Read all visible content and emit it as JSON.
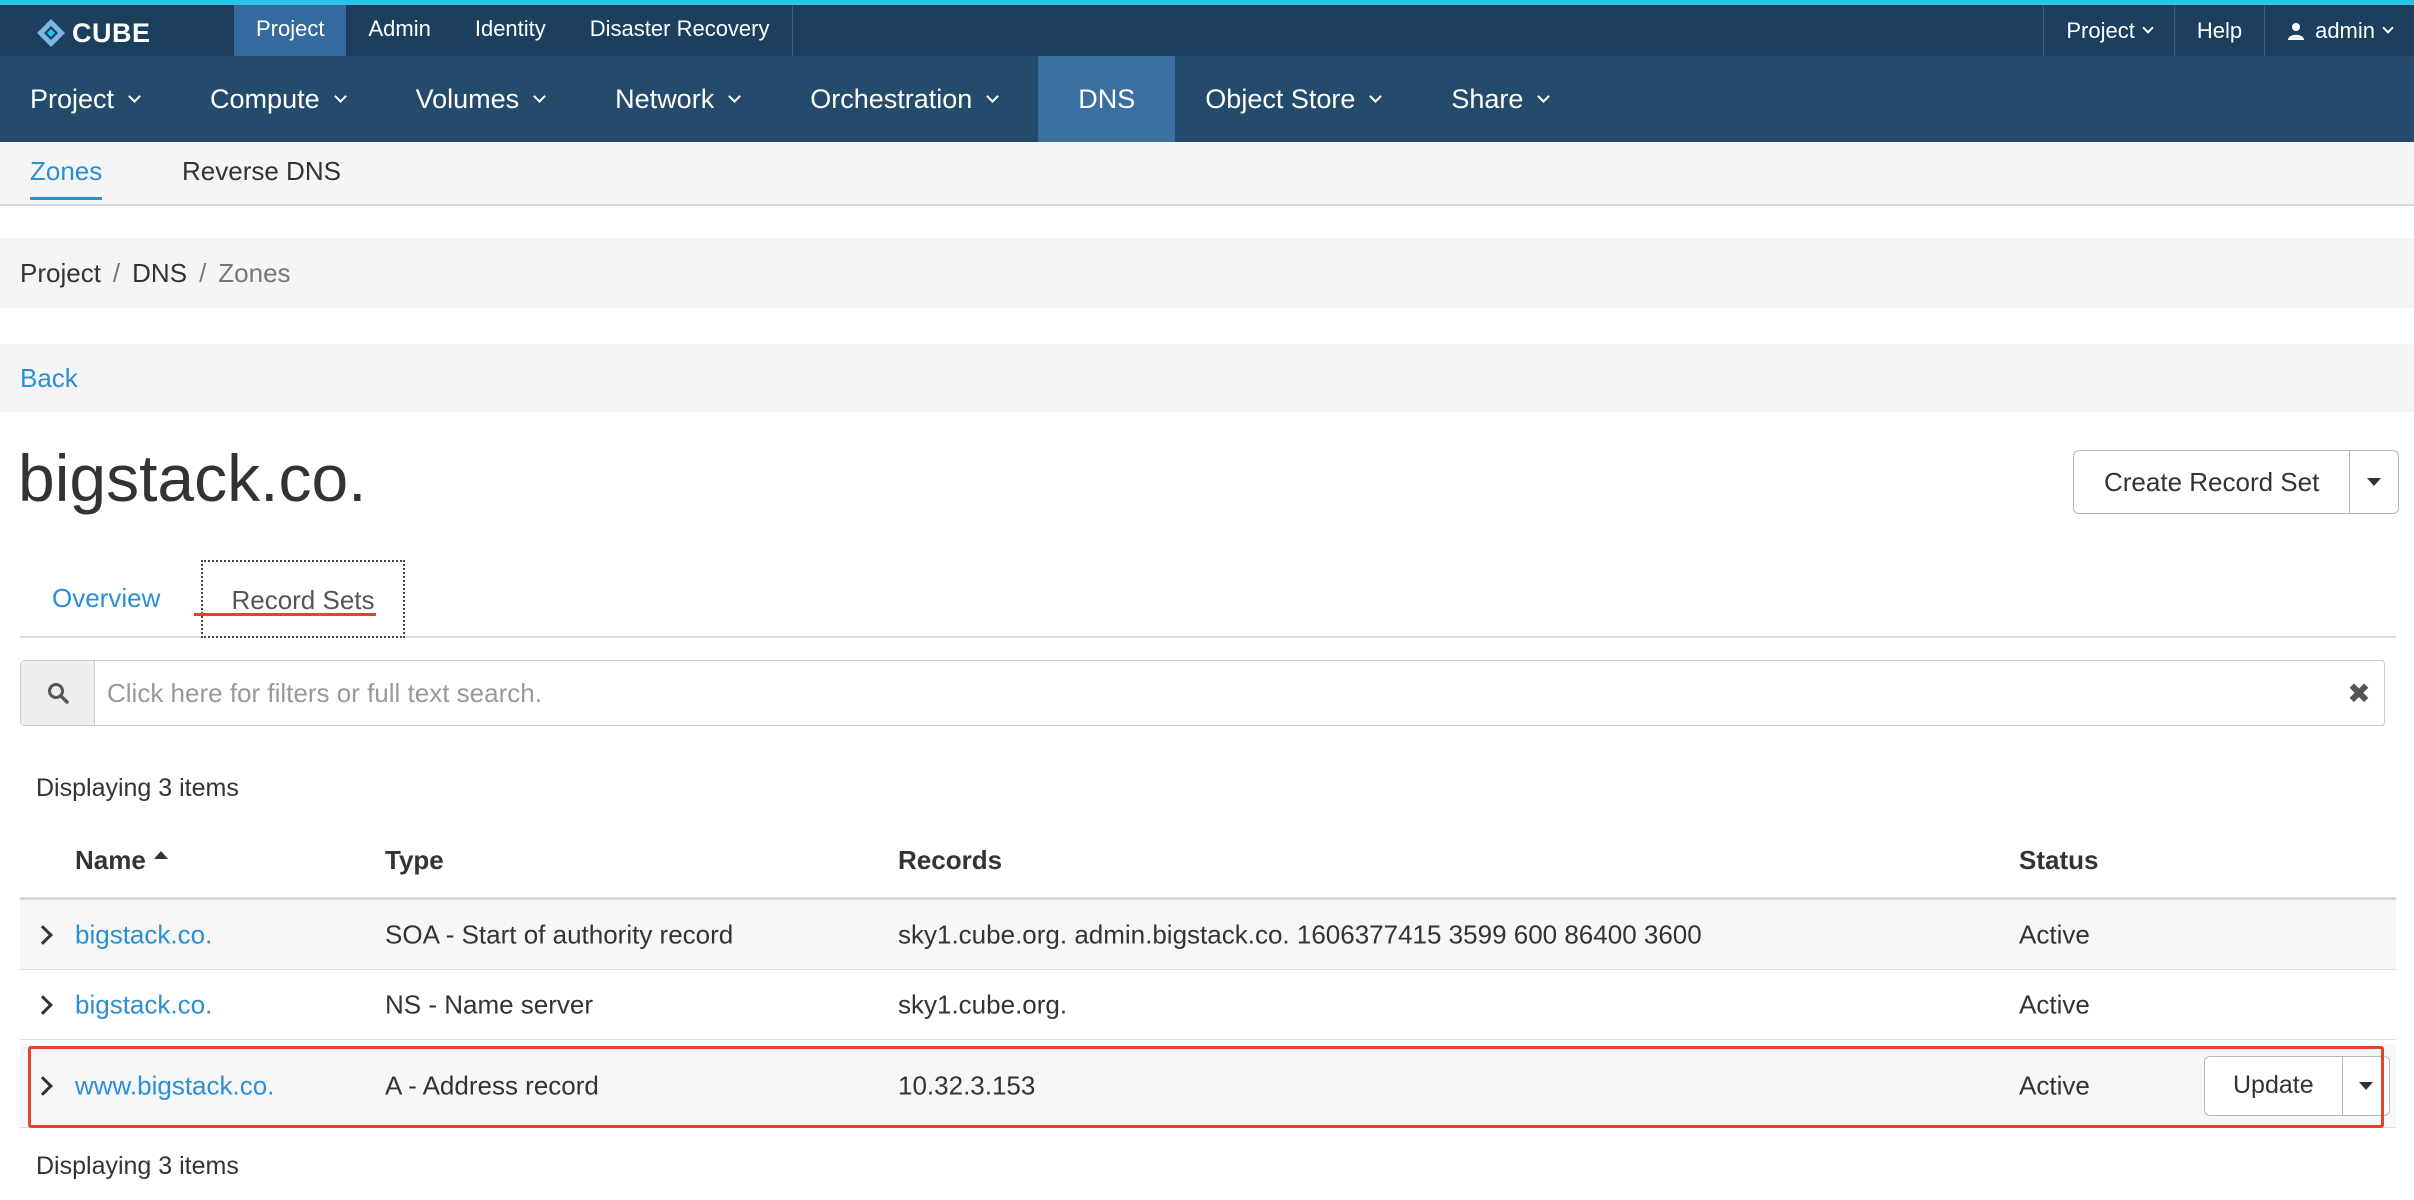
{
  "brand": {
    "name": "CUBE",
    "accent": "#27c3e8",
    "link_color": "#2a8fd4",
    "highlight_color": "#e0442b"
  },
  "topbar": {
    "left_items": [
      "Project",
      "Admin",
      "Identity",
      "Disaster Recovery"
    ],
    "active_left": "Project",
    "right_items": {
      "project": "Project",
      "help": "Help",
      "user": "admin"
    }
  },
  "mainnav": {
    "items": [
      "Project",
      "Compute",
      "Volumes",
      "Network",
      "Orchestration",
      "DNS",
      "Object Store",
      "Share"
    ],
    "active": "DNS"
  },
  "subnav": {
    "items": [
      "Zones",
      "Reverse DNS"
    ],
    "active": "Zones"
  },
  "breadcrumb": {
    "items": [
      "Project",
      "DNS"
    ],
    "current": "Zones",
    "separator": "/"
  },
  "back_link": "Back",
  "page": {
    "title": "bigstack.co.",
    "create_button": "Create Record Set"
  },
  "tabs": {
    "items": [
      "Overview",
      "Record Sets"
    ],
    "active": "Record Sets"
  },
  "search": {
    "placeholder": "Click here for filters or full text search.",
    "value": ""
  },
  "table": {
    "count_text": "Displaying 3 items",
    "columns": [
      "Name",
      "Type",
      "Records",
      "Status"
    ],
    "sort_column": "Name",
    "sort_direction": "ascending",
    "rows": [
      {
        "name": "bigstack.co.",
        "type": "SOA - Start of authority record",
        "records": "sky1.cube.org. admin.bigstack.co. 1606377415 3599 600 86400 3600",
        "status": "Active"
      },
      {
        "name": "bigstack.co.",
        "type": "NS - Name server",
        "records": "sky1.cube.org.",
        "status": "Active"
      },
      {
        "name": "www.bigstack.co.",
        "type": "A - Address record",
        "records": "10.32.3.153",
        "status": "Active",
        "action": "Update",
        "highlighted": true
      }
    ]
  }
}
